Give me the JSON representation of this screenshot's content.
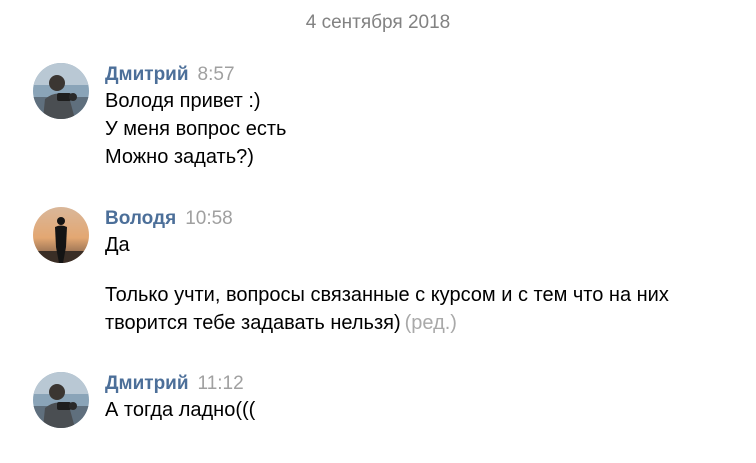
{
  "date_separator": "4 сентября 2018",
  "groups": [
    {
      "author": "Дмитрий",
      "time": "8:57",
      "messages": [
        "Володя привет :)",
        "У меня вопрос есть",
        "Можно задать?)"
      ]
    },
    {
      "author": "Володя",
      "time": "10:58",
      "messages": [
        "Да",
        "Только учти, вопросы связанные с курсом и с тем что на них",
        "творится тебе задавать нельзя)"
      ],
      "edited_label": "(ред.)"
    },
    {
      "author": "Дмитрий",
      "time": "11:12",
      "messages": [
        "А тогда ладно((("
      ]
    }
  ],
  "colors": {
    "author": "#4c6f99",
    "time": "#a0a0a0",
    "date": "#828282"
  },
  "icons": {
    "dmitry_avatar": "avatar-photo-man-with-camera",
    "volodya_avatar": "avatar-silhouette-sunset"
  }
}
